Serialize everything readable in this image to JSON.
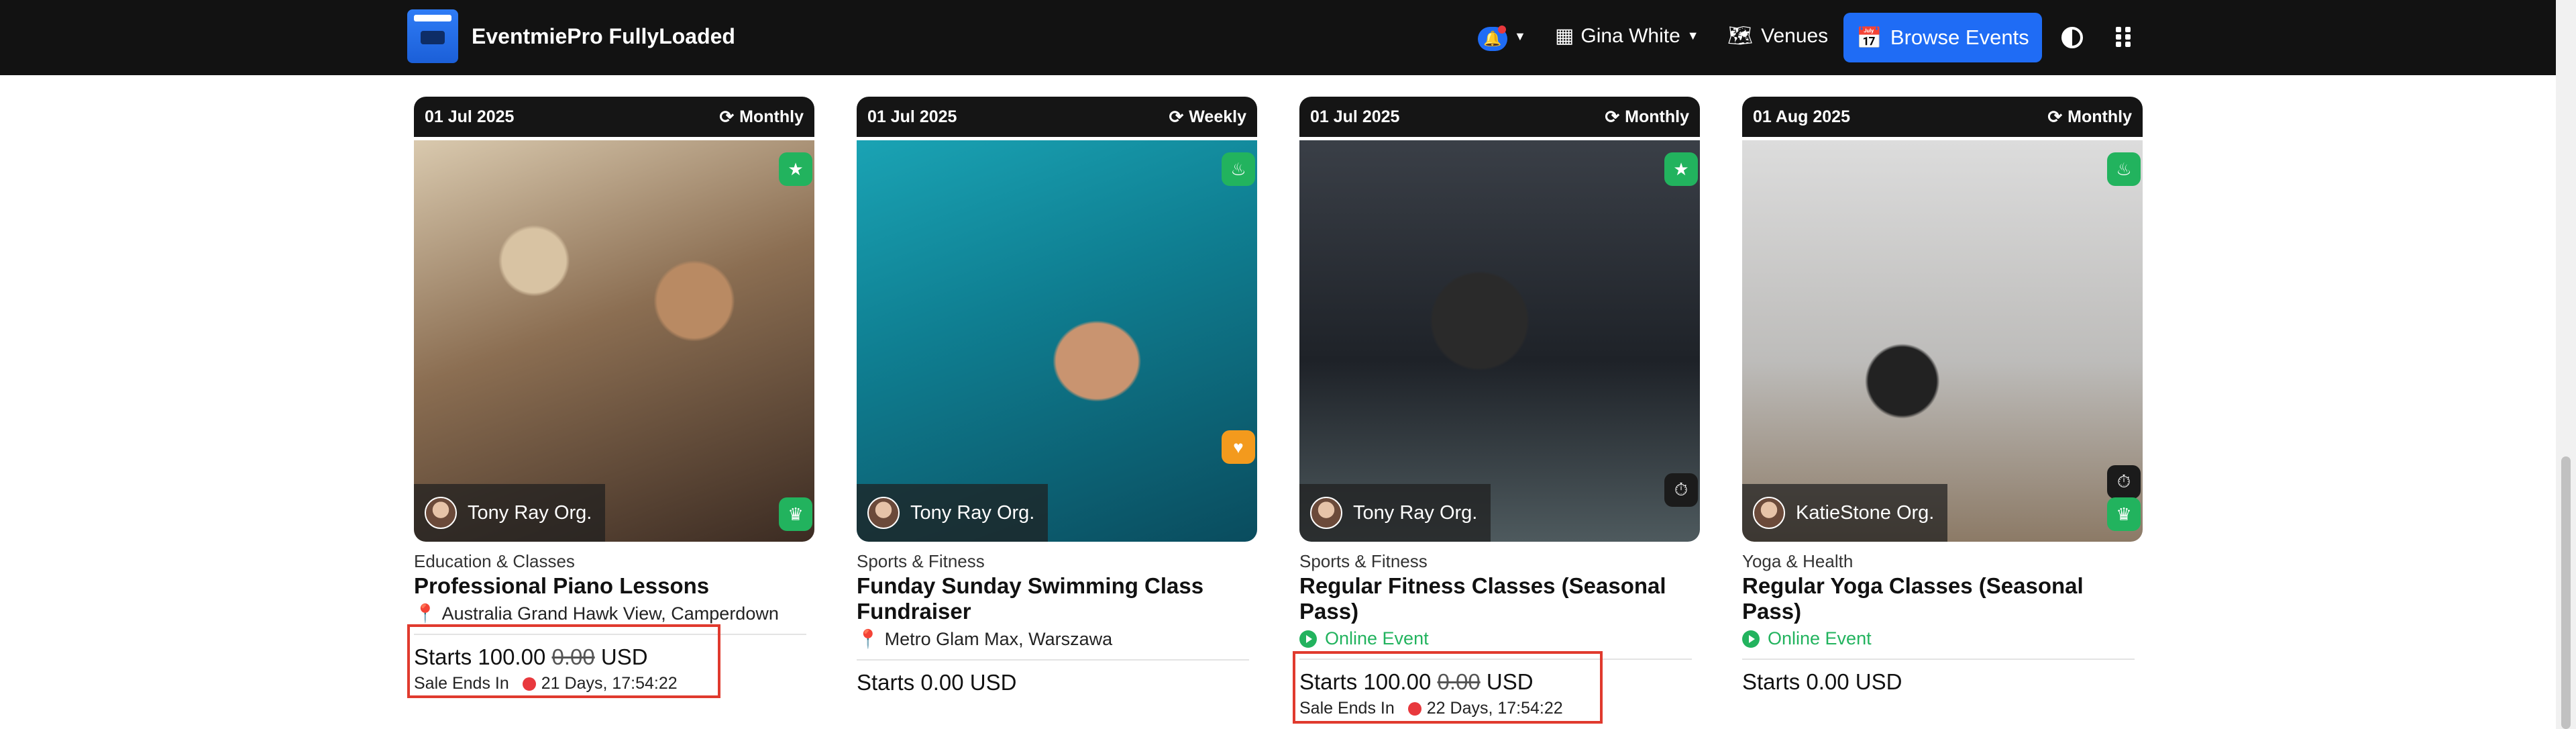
{
  "app": {
    "brand_name": "EventmiePro FullyLoaded"
  },
  "nav": {
    "user_name": "Gina White",
    "venues_label": "Venues",
    "browse_label": "Browse Events"
  },
  "icons": {
    "bell": "bell-icon",
    "user": "user-icon",
    "venues": "map-icon",
    "browse": "calendar-icon",
    "theme": "contrast-icon",
    "apps": "grid-icon",
    "repeat": "repeat-icon",
    "pin": "map-marker-icon"
  },
  "colors": {
    "navbar": "#121212",
    "accent": "#1f6cf5",
    "success": "#22b35e",
    "highlight": "#e03a2e"
  },
  "events": [
    {
      "date": "01 Jul 2025",
      "repeat": "Monthly",
      "organizer": "Tony Ray Org.",
      "category": "Education & Classes",
      "title": "Professional Piano Lessons",
      "venue": "Australia Grand Hawk View, Camperdown",
      "price_prefix": "Starts",
      "price": "100.00",
      "price_old": "0.00",
      "currency": "USD",
      "sale_label": "Sale Ends In",
      "sale_time": "21 Days, 17:54:22"
    },
    {
      "date": "01 Jul 2025",
      "repeat": "Weekly",
      "organizer": "Tony Ray Org.",
      "category": "Sports & Fitness",
      "title": "Funday Sunday Swimming Class Fundraiser",
      "venue": "Metro Glam Max, Warszawa",
      "price_text": "Starts 0.00 USD"
    },
    {
      "date": "01 Jul 2025",
      "repeat": "Monthly",
      "organizer": "Tony Ray Org.",
      "category": "Sports & Fitness",
      "title": "Regular Fitness Classes (Seasonal Pass)",
      "online_label": "Online Event",
      "price_prefix": "Starts",
      "price": "100.00",
      "price_old": "0.00",
      "currency": "USD",
      "sale_label": "Sale Ends In",
      "sale_time": "22 Days, 17:54:22"
    },
    {
      "date": "01 Aug 2025",
      "repeat": "Monthly",
      "organizer": "KatieStone Org.",
      "category": "Yoga & Health",
      "title": "Regular Yoga Classes (Seasonal Pass)",
      "online_label": "Online Event",
      "price_text": "Starts 0.00 USD"
    }
  ]
}
